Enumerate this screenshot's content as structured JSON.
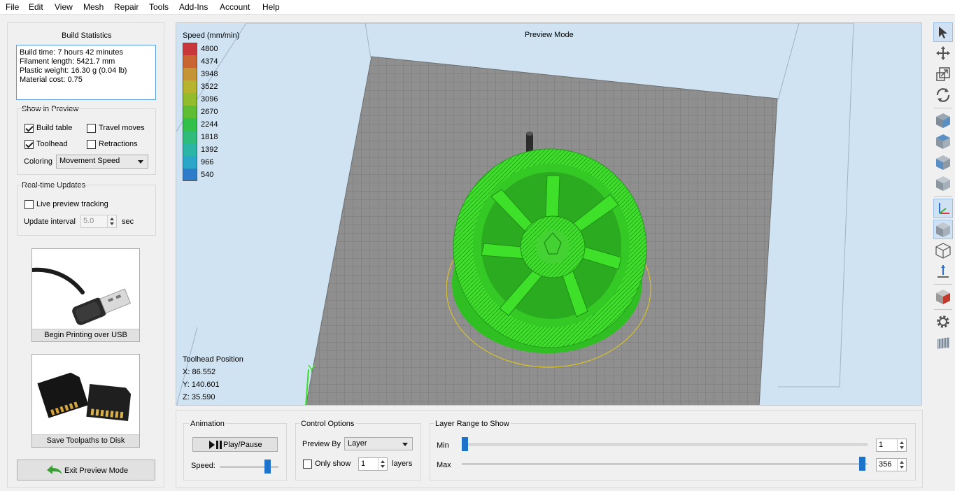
{
  "menu": [
    "File",
    "Edit",
    "View",
    "Mesh",
    "Repair",
    "Tools",
    "Add-Ins",
    "Account",
    "Help"
  ],
  "build_stats": {
    "title": "Build Statistics",
    "lines": [
      "Build time: 7 hours 42 minutes",
      "Filament length: 5421.7 mm",
      "Plastic weight: 16.30 g (0.04 lb)",
      "Material cost: 0.75"
    ]
  },
  "show_in_preview": {
    "title": "Show in Preview",
    "build_table": {
      "label": "Build table",
      "checked": true
    },
    "travel_moves": {
      "label": "Travel moves",
      "checked": false
    },
    "toolhead": {
      "label": "Toolhead",
      "checked": true
    },
    "retractions": {
      "label": "Retractions",
      "checked": false
    },
    "coloring_label": "Coloring",
    "coloring_value": "Movement Speed"
  },
  "realtime": {
    "title": "Real-time Updates",
    "live_label": "Live preview tracking",
    "live_checked": false,
    "interval_label": "Update interval",
    "interval_value": "5.0",
    "interval_unit": "sec"
  },
  "usb_tile": {
    "caption": "Begin Printing over USB",
    "icon": "usb-cable-icon"
  },
  "disk_tile": {
    "caption": "Save Toolpaths to Disk",
    "icon": "sd-card-icon"
  },
  "exit_button": {
    "label": "Exit Preview Mode",
    "icon": "back-arrow-icon"
  },
  "viewport": {
    "mode_title": "Preview Mode",
    "legend_title": "Speed (mm/min)",
    "legend": [
      {
        "value": "4800",
        "color": "#c8373c"
      },
      {
        "value": "4374",
        "color": "#c96533"
      },
      {
        "value": "3948",
        "color": "#c59434"
      },
      {
        "value": "3522",
        "color": "#b6b42f"
      },
      {
        "value": "3096",
        "color": "#93bc2c"
      },
      {
        "value": "2670",
        "color": "#5ebd33"
      },
      {
        "value": "2244",
        "color": "#33c04a"
      },
      {
        "value": "1818",
        "color": "#2fbb7a"
      },
      {
        "value": "1392",
        "color": "#2ab5a7"
      },
      {
        "value": "966",
        "color": "#2aa6c8"
      },
      {
        "value": "540",
        "color": "#2f7cc8"
      }
    ],
    "toolhead_title": "Toolhead Position",
    "x": "X: 86.552",
    "y": "Y: 140.601",
    "z": "Z: 35.590",
    "axis_y_label": "Y",
    "model_color": "#3ee02a"
  },
  "animation": {
    "title": "Animation",
    "play_label": "Play/Pause",
    "speed_label": "Speed:",
    "speed_level": 0.85
  },
  "control_options": {
    "title": "Control Options",
    "preview_by_label": "Preview By",
    "preview_by_value": "Layer",
    "only_show_label": "Only show",
    "only_show_checked": false,
    "only_show_value": "1",
    "layers_label": "layers"
  },
  "layer_range": {
    "title": "Layer Range to Show",
    "min_label": "Min",
    "min_value": "1",
    "max_label": "Max",
    "max_value": "356"
  },
  "toolbar_icons": [
    "select-arrow-icon",
    "move-icon",
    "scale-icon",
    "rotate-icon",
    "view-cube-front-icon",
    "view-cube-top-icon",
    "view-cube-side-icon",
    "view-cube-iso-icon",
    "axes-icon",
    "solid-cube-icon",
    "wireframe-cube-icon",
    "ground-plane-icon",
    "section-cube-icon",
    "settings-gear-icon",
    "toolpath-icon"
  ]
}
